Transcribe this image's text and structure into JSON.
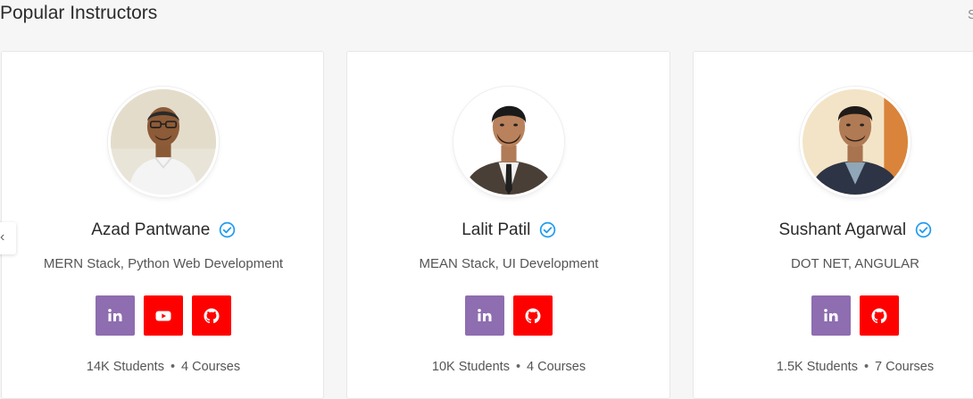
{
  "section": {
    "title": "Popular Instructors"
  },
  "colors": {
    "linkedin": "#8e6db0",
    "youtube": "#ff0000",
    "github": "#ff0000",
    "verified": "#1e9bf0"
  },
  "instructors": [
    {
      "name": "Azad Pantwane",
      "specialty": "MERN Stack, Python Web Development",
      "students": "14K Students",
      "courses": "4 Courses",
      "socials": [
        "linkedin-icon",
        "youtube-icon",
        "github-icon"
      ]
    },
    {
      "name": "Lalit Patil",
      "specialty": "MEAN Stack, UI Development",
      "students": "10K Students",
      "courses": "4 Courses",
      "socials": [
        "linkedin-icon",
        "github-icon"
      ]
    },
    {
      "name": "Sushant Agarwal",
      "specialty": "DOT NET, ANGULAR",
      "students": "1.5K Students",
      "courses": "7 Courses",
      "socials": [
        "linkedin-icon",
        "github-icon"
      ]
    }
  ],
  "carousel": {
    "prev_icon": "chevron-left-icon"
  }
}
